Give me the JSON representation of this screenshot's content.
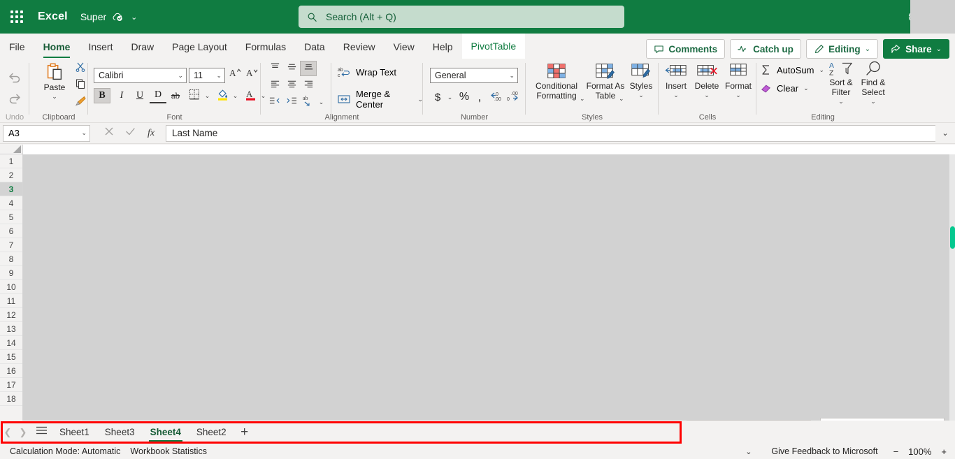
{
  "titlebar": {
    "app_launcher_icon": "waffle-icon",
    "brand": "Excel",
    "document_name": "Super",
    "cloud_status_icon": "cloud-saved-icon",
    "doc_chevron": "⌄",
    "settings_icon": "gear-icon",
    "search": {
      "icon": "search-icon",
      "placeholder": "Search (Alt + Q)",
      "value": ""
    }
  },
  "ribbon_tabs": {
    "items": [
      {
        "label": "File",
        "state": "normal"
      },
      {
        "label": "Home",
        "state": "active"
      },
      {
        "label": "Insert",
        "state": "normal"
      },
      {
        "label": "Draw",
        "state": "normal"
      },
      {
        "label": "Page Layout",
        "state": "normal"
      },
      {
        "label": "Formulas",
        "state": "normal"
      },
      {
        "label": "Data",
        "state": "normal"
      },
      {
        "label": "Review",
        "state": "normal"
      },
      {
        "label": "View",
        "state": "normal"
      },
      {
        "label": "Help",
        "state": "normal"
      },
      {
        "label": "PivotTable",
        "state": "contextual"
      }
    ],
    "actions": {
      "comments": {
        "label": "Comments",
        "icon": "comment-icon"
      },
      "catch_up": {
        "label": "Catch up",
        "icon": "activity-pulse-icon"
      },
      "editing": {
        "label": "Editing",
        "icon": "pencil-icon",
        "chevron": "⌄"
      },
      "share": {
        "label": "Share",
        "icon": "share-icon",
        "chevron": "⌄"
      }
    },
    "collapse_ribbon_icon": "chevron-up-icon"
  },
  "ribbon": {
    "undo": {
      "undo_icon": "undo-arrow-icon",
      "redo_icon": "redo-arrow-icon",
      "group_label": "Undo"
    },
    "clipboard": {
      "paste_label": "Paste",
      "paste_icon": "paste-icon",
      "paste_chevron": "⌄",
      "cut_icon": "scissors-icon",
      "copy_icon": "copy-icon",
      "format_painter_icon": "format-painter-icon",
      "group_label": "Clipboard"
    },
    "font": {
      "font_name": "Calibri",
      "font_size": "11",
      "grow_font_icon": "grow-font-icon",
      "shrink_font_icon": "shrink-font-icon",
      "bold": {
        "icon": "bold-icon",
        "label": "B",
        "active": true
      },
      "italic": {
        "icon": "italic-icon",
        "label": "I"
      },
      "underline": {
        "icon": "underline-icon",
        "label": "U"
      },
      "double_underline": {
        "icon": "double-underline-icon",
        "label": "D"
      },
      "strikethrough": {
        "icon": "strikethrough-icon",
        "label": "ab"
      },
      "borders_icon": "borders-icon",
      "fill_color_icon": "fill-color-icon",
      "font_color_icon": "font-color-icon",
      "fill_color_swatch": "#ffe400",
      "font_color_swatch": "#e81123",
      "group_label": "Font"
    },
    "alignment": {
      "align_top_icon": "align-top-icon",
      "align_middle_icon": "align-middle-icon",
      "align_bottom_icon": "align-bottom-icon",
      "align_left_icon": "align-left-icon",
      "align_center_icon": "align-center-icon",
      "align_right_icon": "align-right-icon",
      "decrease_indent_icon": "decrease-indent-icon",
      "increase_indent_icon": "increase-indent-icon",
      "orientation_icon": "text-orientation-icon",
      "wrap_text_label": "Wrap Text",
      "wrap_text_icon": "wrap-text-icon",
      "merge_center_label": "Merge & Center",
      "merge_center_icon": "merge-cells-icon",
      "merge_chevron": "⌄",
      "group_label": "Alignment"
    },
    "number": {
      "format": "General",
      "currency_icon": "currency-icon",
      "percent_icon": "percent-icon",
      "comma_icon": "comma-style-icon",
      "increase_decimal_icon": "increase-decimal-icon",
      "decrease_decimal_icon": "decrease-decimal-icon",
      "group_label": "Number"
    },
    "styles": {
      "conditional_formatting_label": "Conditional Formatting",
      "conditional_formatting_icon": "conditional-formatting-icon",
      "format_as_table_label": "Format As Table",
      "format_as_table_icon": "format-as-table-icon",
      "styles_label": "Styles",
      "styles_icon": "cell-styles-icon",
      "group_label": "Styles"
    },
    "cells": {
      "insert_label": "Insert",
      "insert_icon": "insert-cells-icon",
      "delete_label": "Delete",
      "delete_icon": "delete-cells-icon",
      "format_label": "Format",
      "format_icon": "format-cells-icon",
      "group_label": "Cells"
    },
    "editing": {
      "autosum_label": "AutoSum",
      "autosum_icon": "sigma-icon",
      "clear_label": "Clear",
      "clear_icon": "eraser-icon",
      "sort_filter_label": "Sort & Filter",
      "sort_filter_icon": "sort-filter-icon",
      "find_select_label": "Find & Select",
      "find_select_icon": "magnifier-icon",
      "group_label": "Editing"
    }
  },
  "formula_bar": {
    "name_box": "A3",
    "name_box_chevron": "⌄",
    "cancel_icon": "cancel-x-icon",
    "enter_icon": "confirm-check-icon",
    "function_icon": "fx-icon",
    "formula_value": "Last Name",
    "expand_chevron": "⌄"
  },
  "grid": {
    "select_all_icon": "select-all-corner-icon",
    "rows": [
      "1",
      "2",
      "3",
      "4",
      "5",
      "6",
      "7",
      "8",
      "9",
      "10",
      "11",
      "12",
      "13",
      "14",
      "15",
      "16",
      "17",
      "18"
    ],
    "selected_row": "3",
    "scrollbar_thumb_color": "#05c88f"
  },
  "sheet_bar": {
    "prev_icon": "chevron-left-icon",
    "next_icon": "chevron-right-icon",
    "all_sheets_icon": "hamburger-sheets-icon",
    "tabs": [
      {
        "label": "Sheet1",
        "active": false
      },
      {
        "label": "Sheet3",
        "active": false
      },
      {
        "label": "Sheet4",
        "active": true
      },
      {
        "label": "Sheet2",
        "active": false
      }
    ],
    "add_sheet_label": "+",
    "highlight_color": "#ff0000"
  },
  "status_bar": {
    "calculation_mode": "Calculation Mode: Automatic",
    "workbook_statistics": "Workbook Statistics",
    "options_chevron": "⌄",
    "feedback": "Give Feedback to Microsoft",
    "zoom_out": "−",
    "zoom_level": "100%",
    "zoom_in": "+"
  }
}
